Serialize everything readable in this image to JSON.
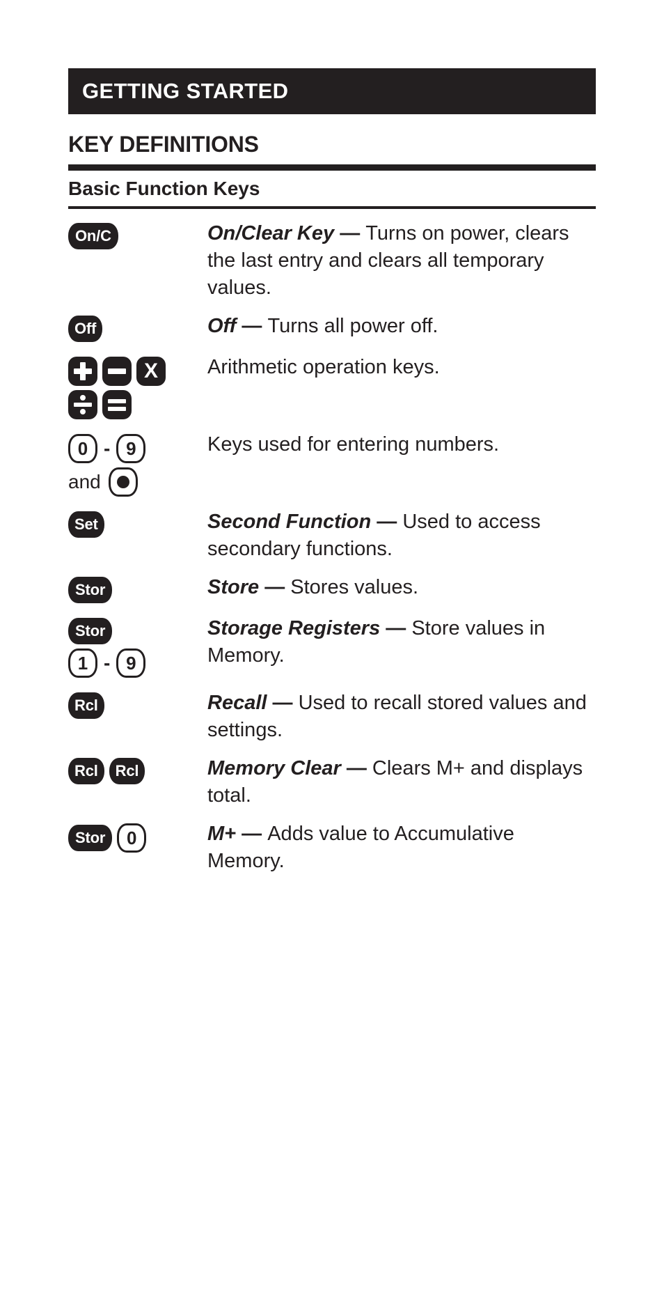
{
  "banner": {
    "title": "GETTING STARTED"
  },
  "section": {
    "heading": "KEY DEFINITIONS",
    "subheading": "Basic Function Keys"
  },
  "rows": [
    {
      "id": "on-clear",
      "keys": [
        [
          {
            "type": "dark",
            "label": "On/C"
          }
        ]
      ],
      "lead": "On/Clear Key",
      "dash": " — ",
      "body": "Turns on power, clears the last entry and clears all temporary values."
    },
    {
      "id": "off",
      "keys": [
        [
          {
            "type": "dark",
            "label": "Off"
          }
        ]
      ],
      "lead": "Off",
      "dash": " — ",
      "body": "Turns all power off."
    },
    {
      "id": "arithmetic",
      "keys": [
        [
          {
            "type": "op",
            "label": "plus"
          },
          {
            "type": "op",
            "label": "minus"
          },
          {
            "type": "op",
            "label": "X"
          }
        ],
        [
          {
            "type": "op",
            "label": "divide"
          },
          {
            "type": "op",
            "label": "equals"
          }
        ]
      ],
      "lead": "",
      "dash": "",
      "body": "Arithmetic operation keys."
    },
    {
      "id": "numbers",
      "keys": [
        [
          {
            "type": "light",
            "label": "0"
          },
          {
            "type": "dash",
            "label": "-"
          },
          {
            "type": "light",
            "label": "9"
          }
        ],
        [
          {
            "type": "text",
            "label": "and"
          },
          {
            "type": "light",
            "label": "dot"
          }
        ]
      ],
      "lead": "",
      "dash": "",
      "body": "Keys used for entering numbers."
    },
    {
      "id": "second-function",
      "keys": [
        [
          {
            "type": "dark",
            "label": "Set"
          }
        ]
      ],
      "lead": "Second Function",
      "dash": " — ",
      "body": "Used to access secondary functions."
    },
    {
      "id": "store",
      "keys": [
        [
          {
            "type": "dark",
            "label": "Stor"
          }
        ]
      ],
      "lead": "Store",
      "dash": " — ",
      "body": "Stores values."
    },
    {
      "id": "storage-registers",
      "keys": [
        [
          {
            "type": "dark",
            "label": "Stor"
          }
        ],
        [
          {
            "type": "light",
            "label": "1"
          },
          {
            "type": "dash",
            "label": "-"
          },
          {
            "type": "light",
            "label": "9"
          }
        ]
      ],
      "lead": "Storage Registers",
      "dash": " — ",
      "body": "Store values in Memory."
    },
    {
      "id": "recall",
      "keys": [
        [
          {
            "type": "dark",
            "label": "Rcl"
          }
        ]
      ],
      "lead": "Recall",
      "dash": " — ",
      "body": "Used to recall stored values and settings."
    },
    {
      "id": "memory-clear",
      "keys": [
        [
          {
            "type": "dark",
            "label": "Rcl"
          },
          {
            "type": "dark",
            "label": "Rcl"
          }
        ]
      ],
      "lead": "Memory Clear ",
      "dash": " — ",
      "body": "Clears M+ and displays total."
    },
    {
      "id": "m-plus",
      "keys": [
        [
          {
            "type": "dark",
            "label": "Stor"
          },
          {
            "type": "light",
            "label": "0"
          }
        ]
      ],
      "lead": "M+",
      "dash": " — ",
      "body": "Adds value to Accumulative Memory."
    }
  ],
  "colors": {
    "ink": "#231f20",
    "paper": "#ffffff"
  }
}
